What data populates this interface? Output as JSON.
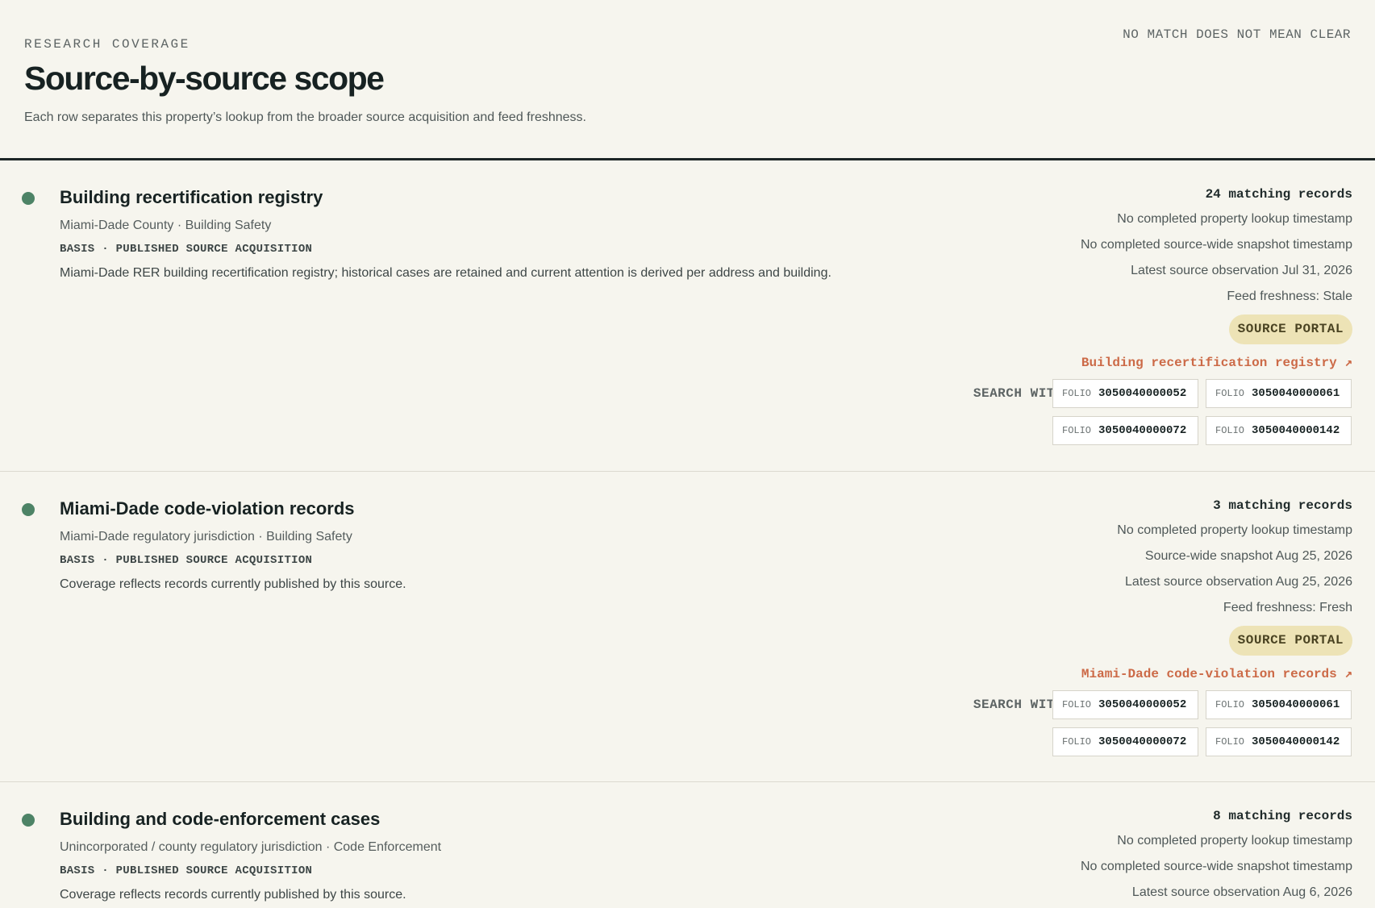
{
  "header": {
    "eyebrow": "RESEARCH COVERAGE",
    "title": "Source-by-source scope",
    "subtitle": "Each row separates this property’s lookup from the broader source acquisition and feed freshness.",
    "notice": "NO MATCH DOES NOT MEAN CLEAR"
  },
  "colors": {
    "status_dot": "#4d8366",
    "pill_bg": "#ede3b6",
    "link": "#cc6a47",
    "rule": "#1d2626"
  },
  "sources": [
    {
      "name": "Building recertification registry",
      "jurisdiction": "Miami-Dade County · Building Safety",
      "basis": "BASIS · PUBLISHED SOURCE ACQUISITION",
      "description": "Miami-Dade RER building recertification registry; historical cases are retained and current attention is derived per address and building.",
      "count": "24 matching records",
      "lookup": "No completed property lookup timestamp",
      "snapshot": "No completed source-wide snapshot timestamp",
      "observation": "Latest source observation Jul 31, 2026",
      "freshness": "Feed freshness: Stale",
      "pill": "SOURCE PORTAL",
      "link": "Building recertification registry ↗",
      "search_label": "SEARCH WITH",
      "folios": [
        {
          "key": "FOLIO",
          "value": "3050040000052"
        },
        {
          "key": "FOLIO",
          "value": "3050040000061"
        },
        {
          "key": "FOLIO",
          "value": "3050040000072"
        },
        {
          "key": "FOLIO",
          "value": "3050040000142"
        }
      ]
    },
    {
      "name": "Miami-Dade code-violation records",
      "jurisdiction": "Miami-Dade regulatory jurisdiction · Building Safety",
      "basis": "BASIS · PUBLISHED SOURCE ACQUISITION",
      "description": "Coverage reflects records currently published by this source.",
      "count": "3 matching records",
      "lookup": "No completed property lookup timestamp",
      "snapshot": "Source-wide snapshot Aug 25, 2026",
      "observation": "Latest source observation Aug 25, 2026",
      "freshness": "Feed freshness: Fresh",
      "pill": "SOURCE PORTAL",
      "link": "Miami-Dade code-violation records ↗",
      "search_label": "SEARCH WITH",
      "folios": [
        {
          "key": "FOLIO",
          "value": "3050040000052"
        },
        {
          "key": "FOLIO",
          "value": "3050040000061"
        },
        {
          "key": "FOLIO",
          "value": "3050040000072"
        },
        {
          "key": "FOLIO",
          "value": "3050040000142"
        }
      ]
    },
    {
      "name": "Building and code-enforcement cases",
      "jurisdiction": "Unincorporated / county regulatory jurisdiction · Code Enforcement",
      "basis": "BASIS · PUBLISHED SOURCE ACQUISITION",
      "description": "Coverage reflects records currently published by this source.",
      "count": "8 matching records",
      "lookup": "No completed property lookup timestamp",
      "snapshot": "No completed source-wide snapshot timestamp",
      "observation": "Latest source observation Aug 6, 2026"
    }
  ]
}
